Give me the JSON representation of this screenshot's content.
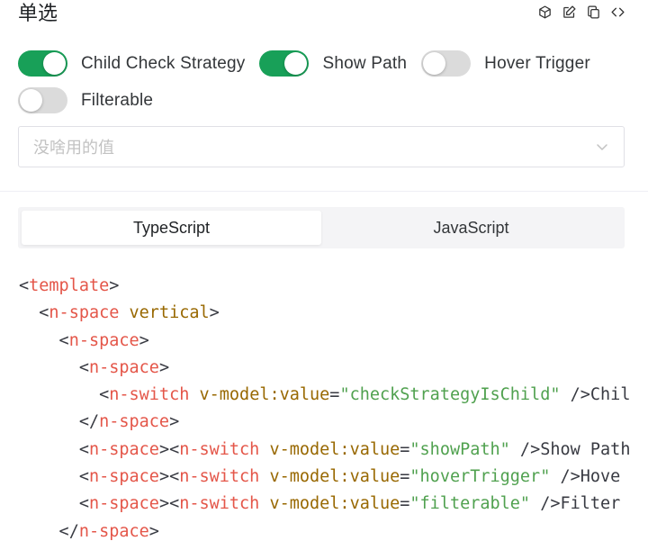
{
  "header": {
    "title": "单选",
    "icons": [
      "cube-icon",
      "edit-icon",
      "copy-icon",
      "code-icon"
    ]
  },
  "switches": [
    {
      "label": "Child Check Strategy",
      "on": true
    },
    {
      "label": "Show Path",
      "on": true
    },
    {
      "label": "Hover Trigger",
      "on": false
    },
    {
      "label": "Filterable",
      "on": false
    }
  ],
  "select": {
    "placeholder": "没啥用的值"
  },
  "tabs": [
    {
      "label": "TypeScript",
      "active": true
    },
    {
      "label": "JavaScript",
      "active": false
    }
  ],
  "colors": {
    "accent": "#18a058",
    "tag": "#e45649",
    "attr": "#986801",
    "string": "#50a14f"
  },
  "code_lines": [
    [
      [
        "p",
        "<"
      ],
      [
        "tag",
        "template"
      ],
      [
        "p",
        ">"
      ]
    ],
    [
      [
        "p",
        "  <"
      ],
      [
        "tag",
        "n-space"
      ],
      [
        "p",
        " "
      ],
      [
        "attr",
        "vertical"
      ],
      [
        "p",
        ">"
      ]
    ],
    [
      [
        "p",
        "    <"
      ],
      [
        "tag",
        "n-space"
      ],
      [
        "p",
        ">"
      ]
    ],
    [
      [
        "p",
        "      <"
      ],
      [
        "tag",
        "n-space"
      ],
      [
        "p",
        ">"
      ]
    ],
    [
      [
        "p",
        "        <"
      ],
      [
        "tag",
        "n-switch"
      ],
      [
        "p",
        " "
      ],
      [
        "attr",
        "v-model:value"
      ],
      [
        "p",
        "="
      ],
      [
        "str",
        "\"checkStrategyIsChild\""
      ],
      [
        "p",
        " />"
      ],
      [
        "txt",
        "Chil"
      ]
    ],
    [
      [
        "p",
        "      </"
      ],
      [
        "tag",
        "n-space"
      ],
      [
        "p",
        ">"
      ]
    ],
    [
      [
        "p",
        "      <"
      ],
      [
        "tag",
        "n-space"
      ],
      [
        "p",
        "><"
      ],
      [
        "tag",
        "n-switch"
      ],
      [
        "p",
        " "
      ],
      [
        "attr",
        "v-model:value"
      ],
      [
        "p",
        "="
      ],
      [
        "str",
        "\"showPath\""
      ],
      [
        "p",
        " />"
      ],
      [
        "txt",
        "Show Path"
      ]
    ],
    [
      [
        "p",
        "      <"
      ],
      [
        "tag",
        "n-space"
      ],
      [
        "p",
        "><"
      ],
      [
        "tag",
        "n-switch"
      ],
      [
        "p",
        " "
      ],
      [
        "attr",
        "v-model:value"
      ],
      [
        "p",
        "="
      ],
      [
        "str",
        "\"hoverTrigger\""
      ],
      [
        "p",
        " />"
      ],
      [
        "txt",
        "Hove"
      ]
    ],
    [
      [
        "p",
        "      <"
      ],
      [
        "tag",
        "n-space"
      ],
      [
        "p",
        "><"
      ],
      [
        "tag",
        "n-switch"
      ],
      [
        "p",
        " "
      ],
      [
        "attr",
        "v-model:value"
      ],
      [
        "p",
        "="
      ],
      [
        "str",
        "\"filterable\""
      ],
      [
        "p",
        " />"
      ],
      [
        "txt",
        "Filter"
      ]
    ],
    [
      [
        "p",
        "    </"
      ],
      [
        "tag",
        "n-space"
      ],
      [
        "p",
        ">"
      ]
    ]
  ]
}
